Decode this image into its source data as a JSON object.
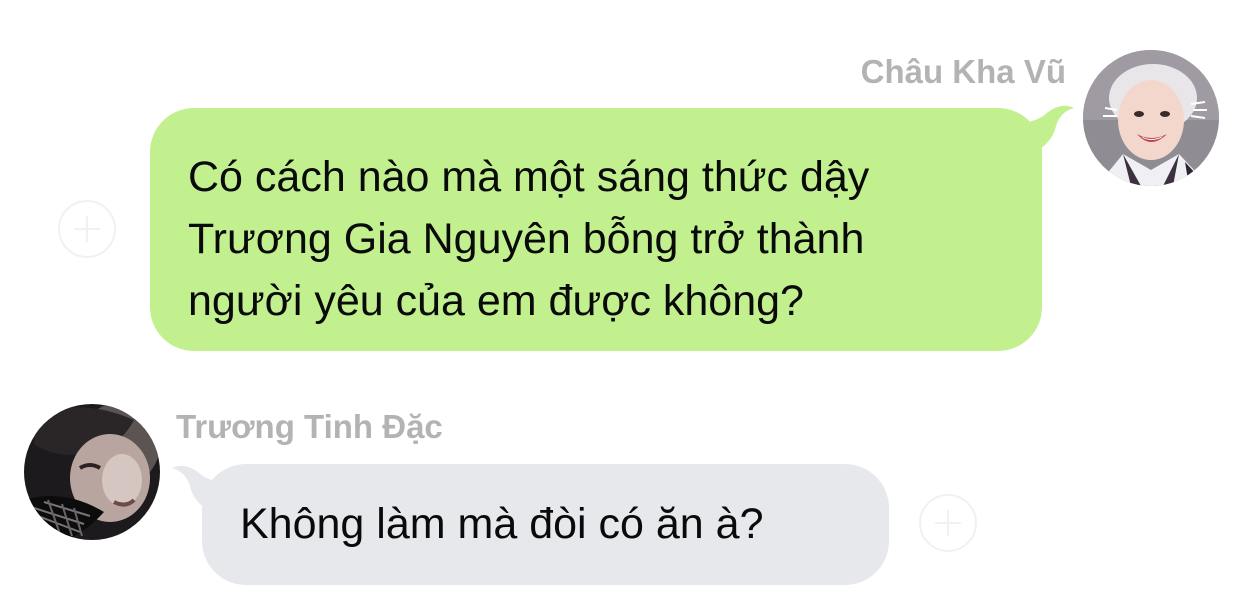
{
  "messages": [
    {
      "direction": "outgoing",
      "sender": "Châu Kha Vũ",
      "lines": [
        "Có cách nào mà một sáng thức dậy",
        "Trương Gia Nguyên bỗng trở thành",
        "người yêu của em được không?"
      ],
      "bubble_color": "#c2f08e",
      "avatar_icon": "profile-photo-smiling-person"
    },
    {
      "direction": "incoming",
      "sender": "Trương Tinh Đặc",
      "lines": [
        "Không làm mà đòi có ăn à?"
      ],
      "bubble_color": "#e6e8ec",
      "avatar_icon": "profile-photo-dark-portrait"
    }
  ],
  "colors": {
    "sender_name": "#b3b3b3",
    "text": "#0a0a0a",
    "reaction_button": "#f1f1f1"
  }
}
